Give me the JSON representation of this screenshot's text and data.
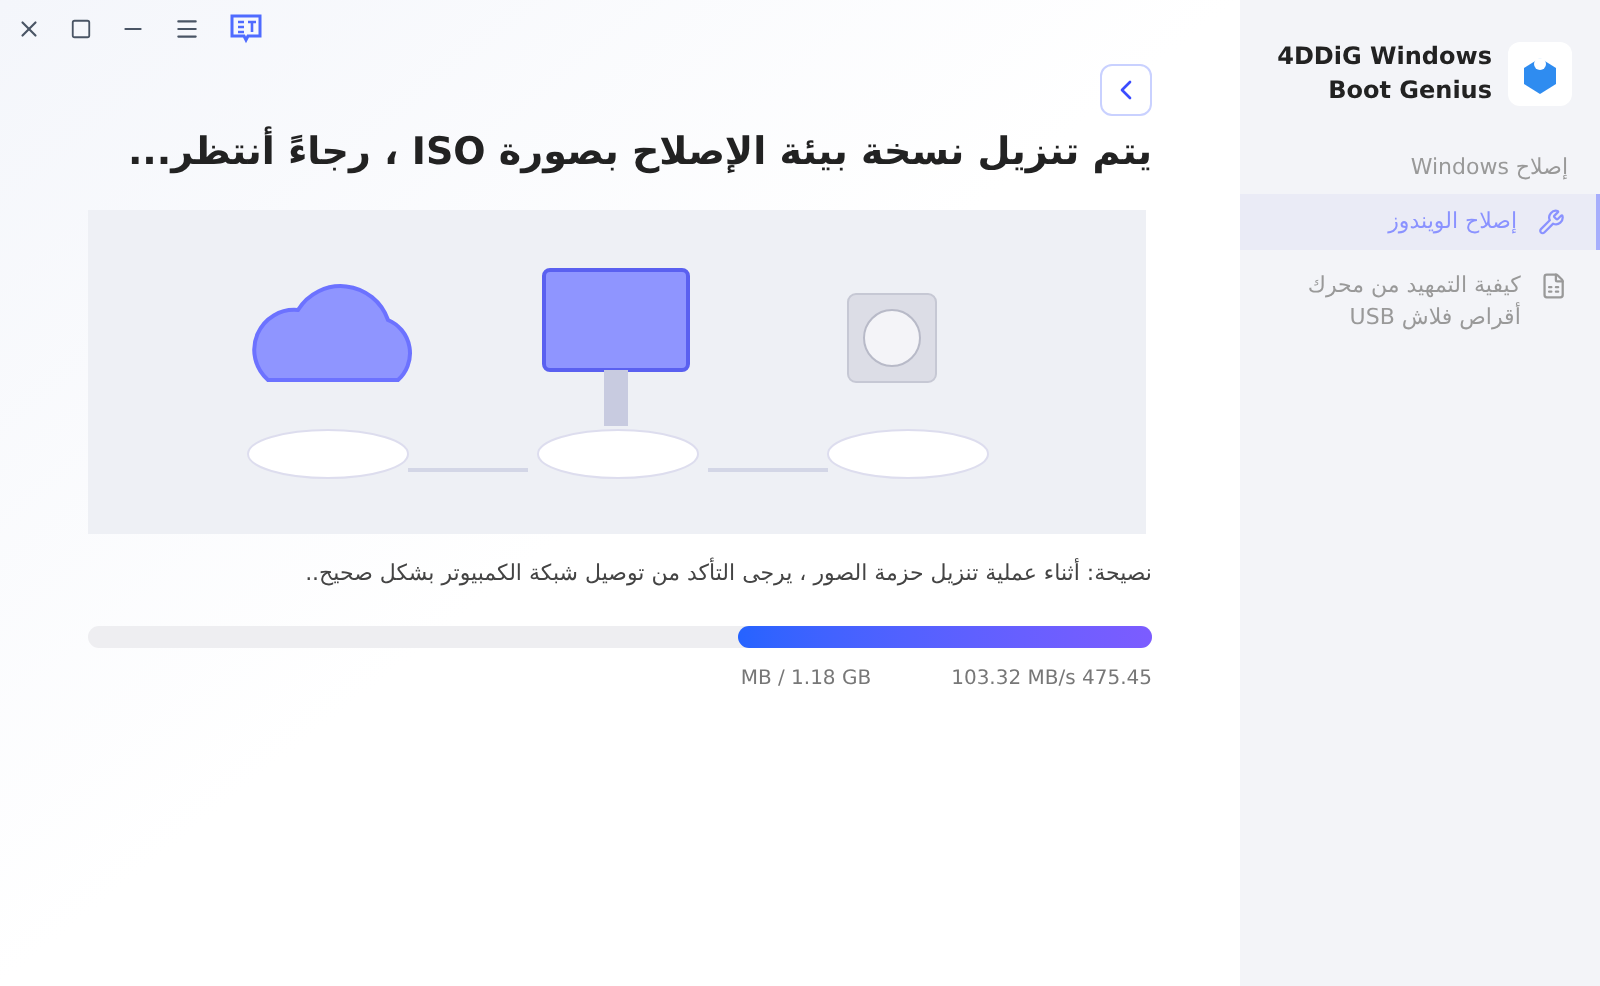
{
  "title": "يتم تنزيل نسخة بيئة الإصلاح بصورة ISO ، رجاءً أنتظر...",
  "tip": "نصيحة: أثناء عملية تنزيل حزمة الصور ، يرجى التأكد من توصيل شبكة الكمبيوتر بشكل صحيح..",
  "progress": {
    "level": 0.39,
    "size": "MB / 1.18 GB",
    "speed": "103.32 MB/s 475.45"
  },
  "sidebar": {
    "app_name": "4DDiG Windows Boot Genius",
    "section": "إصلاح Windows",
    "items": [
      {
        "label": "إصلاح الويندوز",
        "selected": true,
        "kind": "wrench"
      },
      {
        "label": "كيفية التمهيد من محرك أقراص فلاش USB",
        "selected": false,
        "kind": "file"
      }
    ]
  }
}
